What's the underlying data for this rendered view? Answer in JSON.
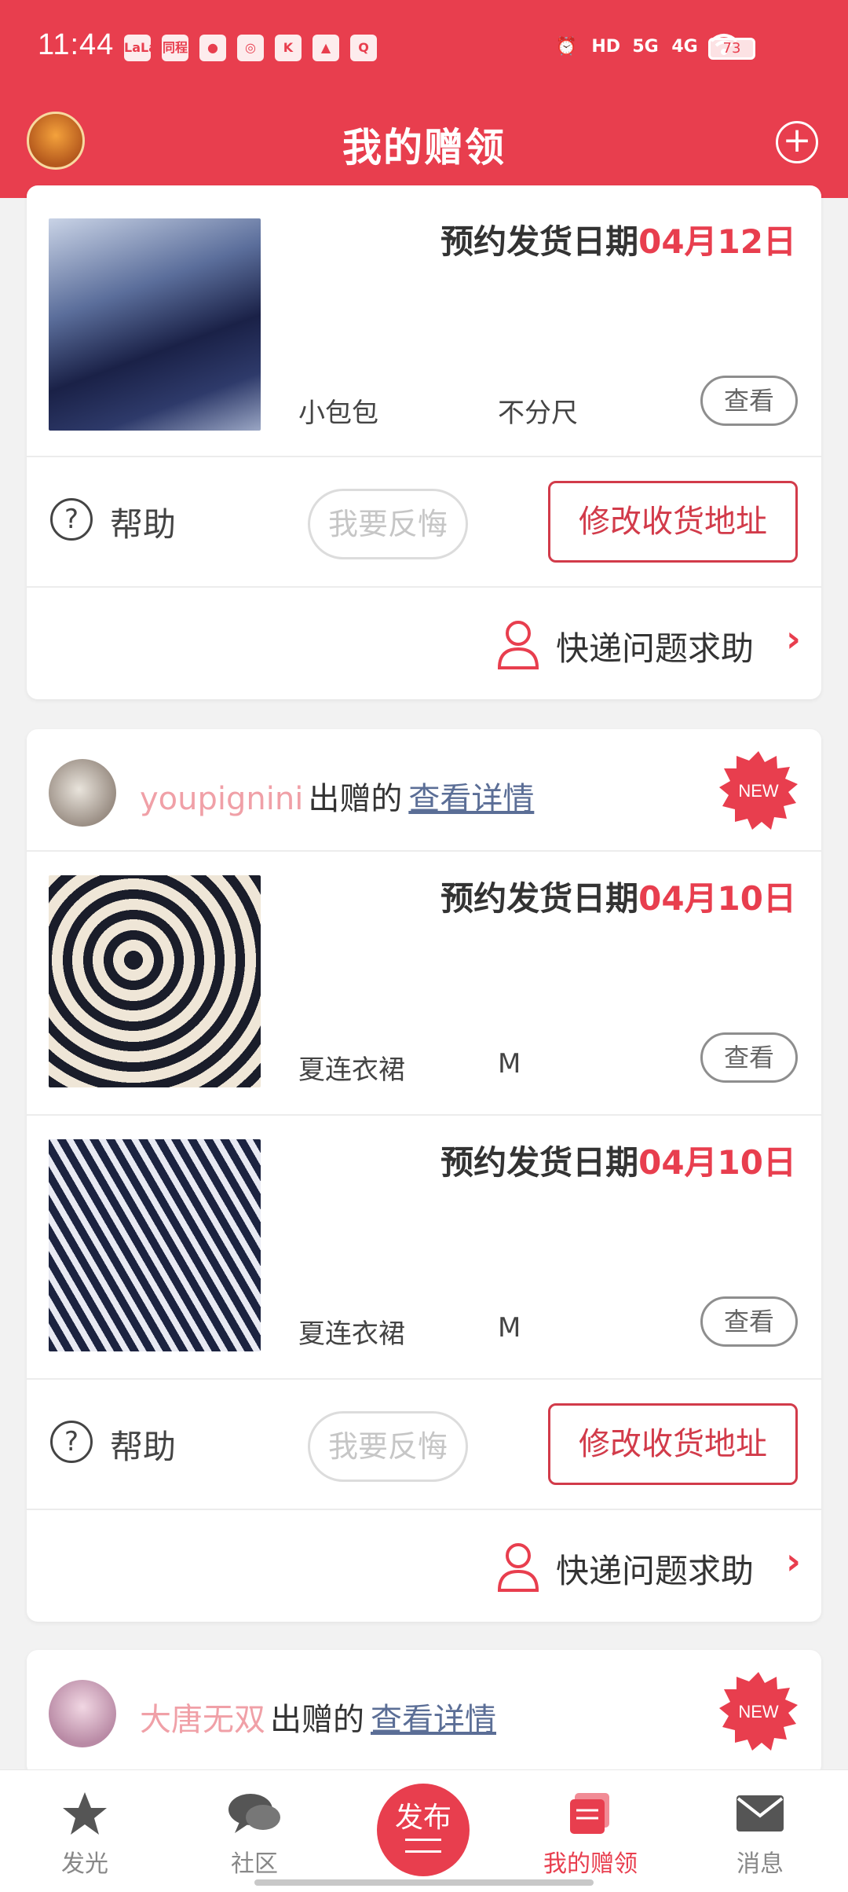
{
  "status_bar": {
    "time": "11:44",
    "notifications": [
      "LaLa",
      "同程",
      "●",
      "◎",
      "K",
      "▲",
      "Q"
    ],
    "signal_labels": [
      "HD",
      "5G",
      "4G"
    ],
    "battery": "73"
  },
  "header": {
    "title": "我的赠领",
    "plus": "+"
  },
  "cards": [
    {
      "items": [
        {
          "ship_prefix": "预约发货日期",
          "ship_date": "04月12日",
          "name": "小包包",
          "size": "不分尺",
          "view_label": "查看"
        }
      ],
      "help_icon": "?",
      "help_label": "帮助",
      "regret_label": "我要反悔",
      "address_label": "修改收货地址",
      "express_label": "快递问题求助",
      "express_arrow": "›"
    },
    {
      "donor_name": "youpignini",
      "donor_verb": "出赠的",
      "detail_link": "查看详情",
      "badge": "NEW",
      "items": [
        {
          "ship_prefix": "预约发货日期",
          "ship_date": "04月10日",
          "name": "夏连衣裙",
          "size": "M",
          "view_label": "查看"
        },
        {
          "ship_prefix": "预约发货日期",
          "ship_date": "04月10日",
          "name": "夏连衣裙",
          "size": "M",
          "view_label": "查看"
        }
      ],
      "help_icon": "?",
      "help_label": "帮助",
      "regret_label": "我要反悔",
      "address_label": "修改收货地址",
      "express_label": "快递问题求助",
      "express_arrow": "›"
    },
    {
      "donor_name": "大唐无双",
      "donor_verb": "出赠的",
      "detail_link": "查看详情",
      "badge": "NEW"
    }
  ],
  "bottom_nav": {
    "items": [
      {
        "label": "发光",
        "icon": "star-icon"
      },
      {
        "label": "社区",
        "icon": "chat-bubbles-icon"
      },
      {
        "label": "我的赠领",
        "icon": "book-stack-icon"
      },
      {
        "label": "消息",
        "icon": "envelope-icon"
      }
    ],
    "publish_label": "发布",
    "active": "我的赠领"
  },
  "colors": {
    "brand_red": "#e83e4e",
    "donor_name_pink": "#f0a0a7",
    "link_blue": "#5b6e96"
  }
}
